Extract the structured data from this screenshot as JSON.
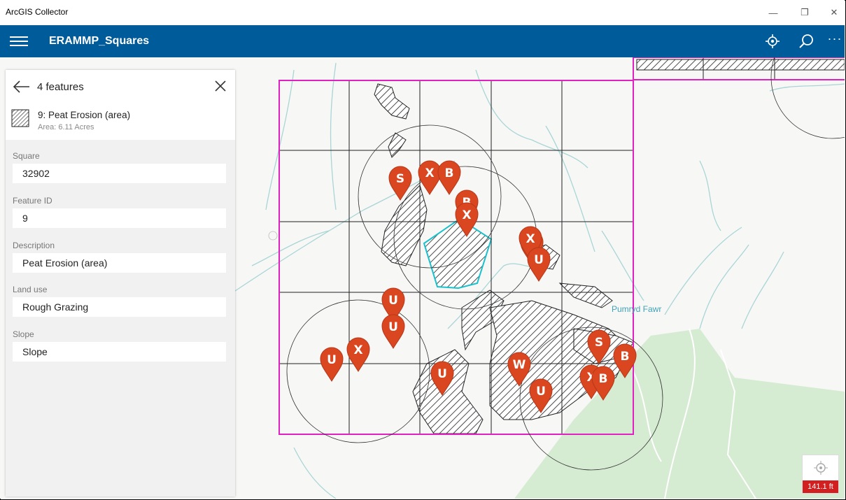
{
  "window": {
    "title": "ArcGIS Collector",
    "minimize": "—",
    "restore": "❐",
    "close": "✕"
  },
  "header": {
    "title": "ERAMMP_Squares",
    "more": "···"
  },
  "panel": {
    "count_label": "4 features",
    "feature": {
      "title": "9: Peat Erosion (area)",
      "subtitle": "Area: 6.11 Acres"
    },
    "fields": [
      {
        "label": "Square",
        "value": "32902"
      },
      {
        "label": "Feature ID",
        "value": "9"
      },
      {
        "label": "Description",
        "value": "Peat Erosion (area)"
      },
      {
        "label": "Land use",
        "value": "Rough Grazing"
      },
      {
        "label": "Slope",
        "value": "Slope"
      }
    ]
  },
  "map": {
    "place_label": "Pumryd Fawr",
    "scale": "141.1 ft",
    "pins": [
      "S",
      "X",
      "B",
      "B",
      "X",
      "B",
      "X",
      "U",
      "U",
      "U",
      "U",
      "X",
      "U",
      "W",
      "U",
      "S",
      "B",
      "X",
      "B"
    ]
  },
  "colors": {
    "header": "#005b9a",
    "pin": "#d9461f",
    "square_outline": "#e020c0",
    "selection": "#19c1cc"
  }
}
